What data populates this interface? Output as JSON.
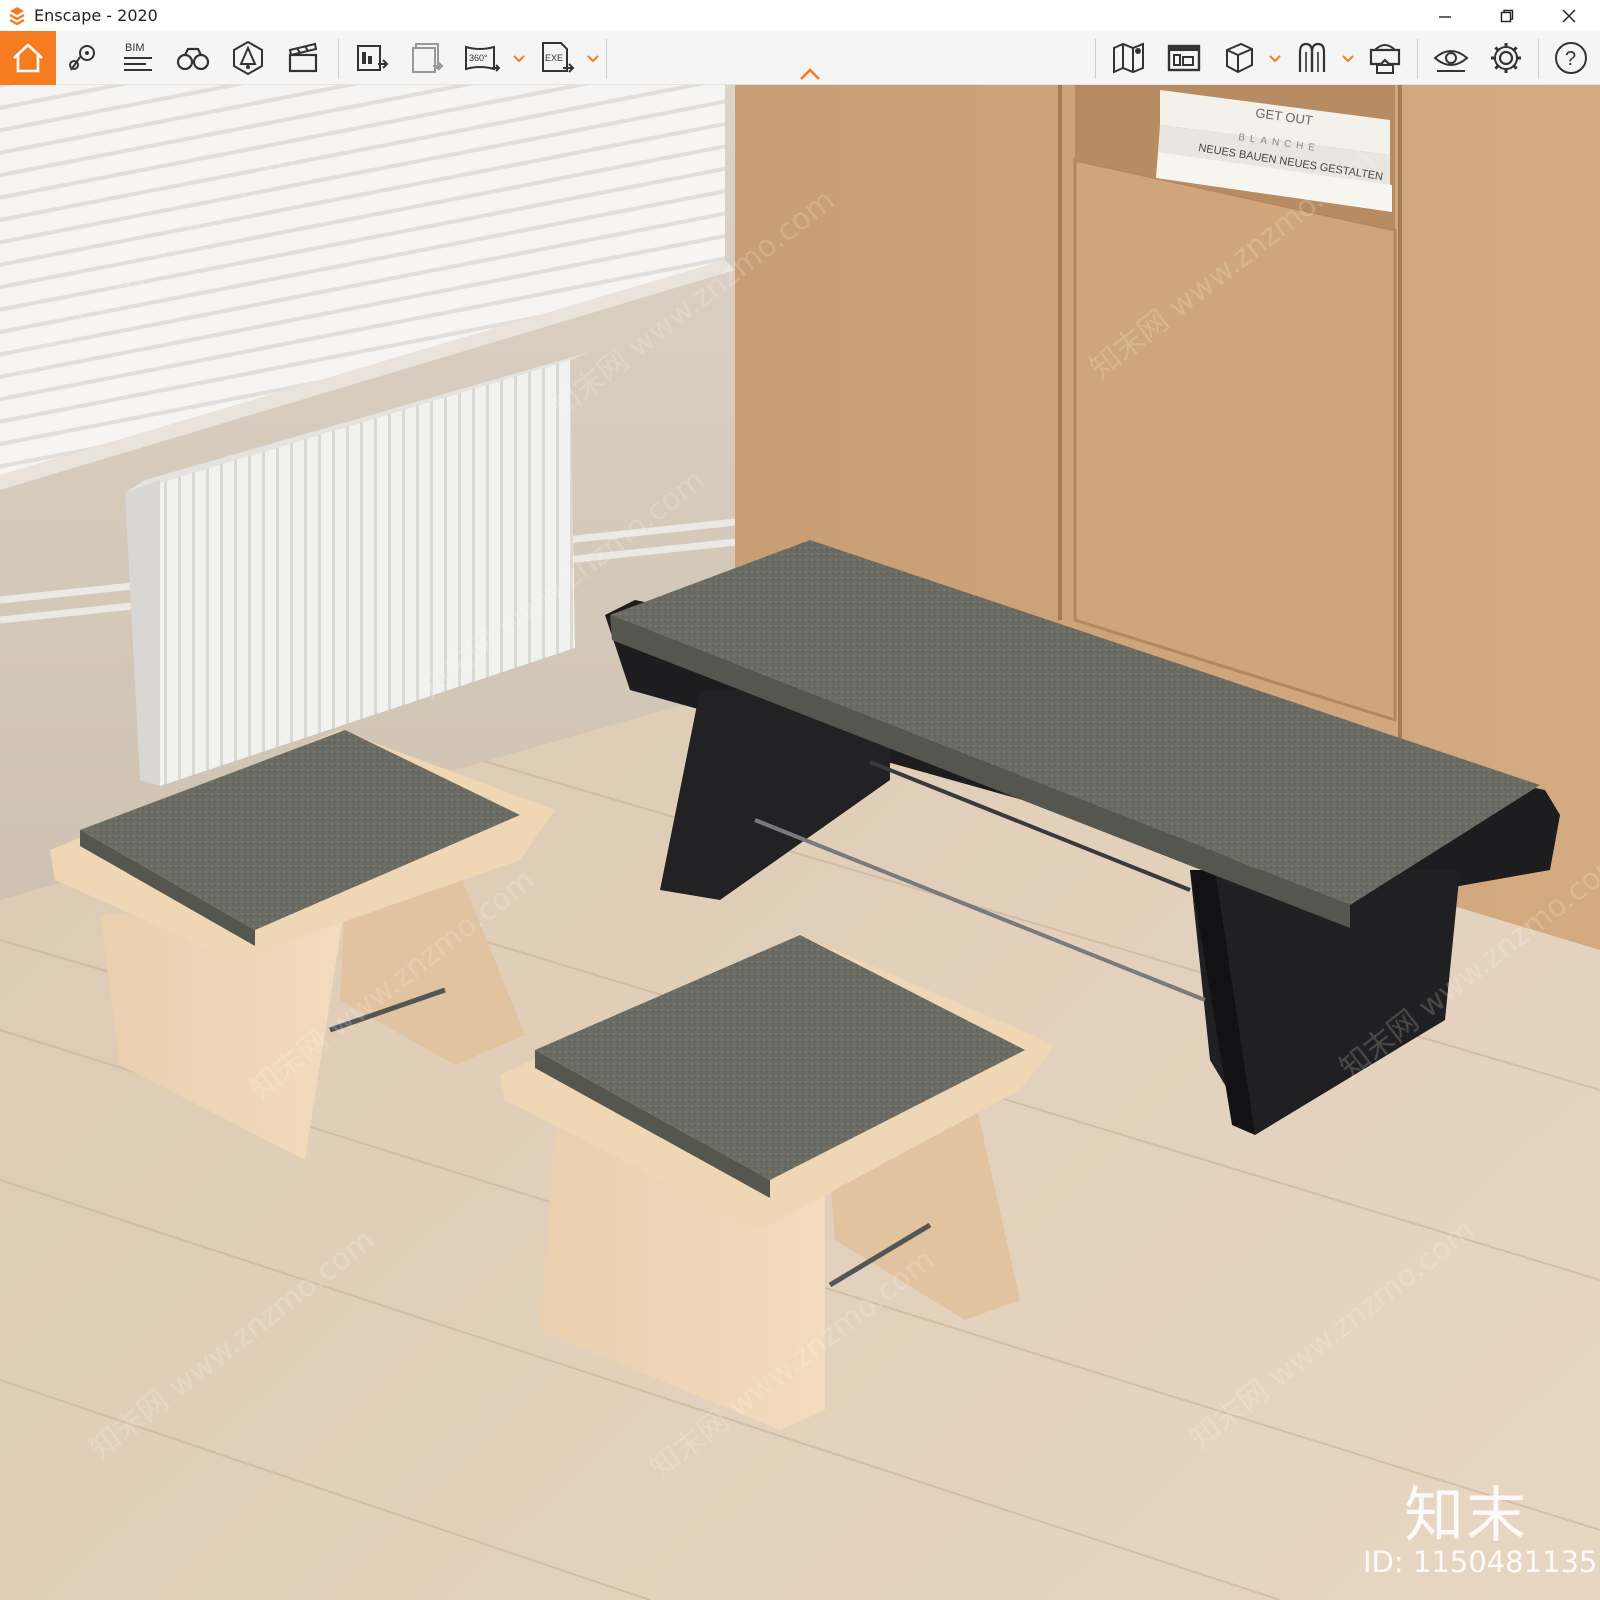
{
  "window": {
    "title": "Enscape - 2020",
    "minimize_glyph": "—",
    "close_glyph": "✕"
  },
  "toolbar": {
    "accent_color": "#f57c21",
    "items": [
      {
        "icon": "home-icon",
        "label": ""
      },
      {
        "icon": "location-pin-icon",
        "label": ""
      },
      {
        "icon": "bim-icon",
        "label": "BIM"
      },
      {
        "icon": "binoculars-icon",
        "label": ""
      },
      {
        "icon": "light-view-icon",
        "label": ""
      },
      {
        "icon": "clapperboard-icon",
        "label": ""
      },
      {
        "icon": "screenshot-export-icon",
        "label": ""
      },
      {
        "icon": "batch-export-icon",
        "label": ""
      },
      {
        "icon": "panorama-360-icon",
        "label": "360°"
      },
      {
        "icon": "exe-export-icon",
        "label": "EXE"
      },
      {
        "icon": "map-icon",
        "label": ""
      },
      {
        "icon": "asset-library-icon",
        "label": ""
      },
      {
        "icon": "cube-icon",
        "label": ""
      },
      {
        "icon": "material-editor-icon",
        "label": ""
      },
      {
        "icon": "vr-headset-icon",
        "label": ""
      },
      {
        "icon": "visual-settings-icon",
        "label": ""
      },
      {
        "icon": "settings-gear-icon",
        "label": ""
      },
      {
        "icon": "help-icon",
        "label": "?"
      }
    ]
  },
  "scene": {
    "book_spine_1": "GET OUT",
    "book_spine_2": "BLANCHE",
    "book_spine_3": "NEUES BAUEN NEUES GESTALTEN"
  },
  "watermark": {
    "logo_text": "知末",
    "id_text": "ID: 1150481135",
    "diagonal_text": "知末网 www.znzmo.com"
  }
}
